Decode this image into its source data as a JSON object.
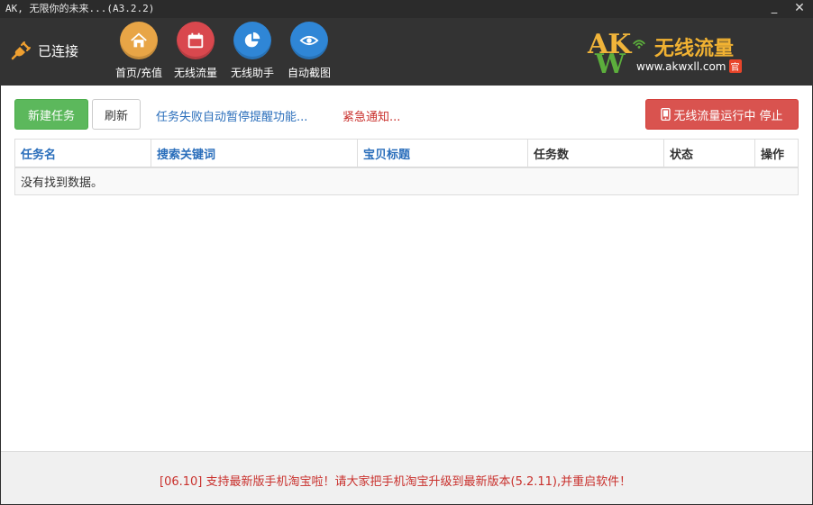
{
  "window": {
    "title": "AK, 无限你的未来...(A3.2.2)",
    "minimize_label": "_",
    "close_label": "✕"
  },
  "header": {
    "status": "已连接",
    "nav": [
      {
        "label": "首页/充值",
        "icon": "home-icon",
        "color": "#e8a546"
      },
      {
        "label": "无线流量",
        "icon": "calendar-icon",
        "color": "#d9484e"
      },
      {
        "label": "无线助手",
        "icon": "pie-chart-icon",
        "color": "#2f86d6"
      },
      {
        "label": "自动截图",
        "icon": "eye-icon",
        "color": "#2f86d6"
      }
    ]
  },
  "logo": {
    "letters_top": "AK",
    "letters_bottom": "W",
    "title": "无线流量",
    "url": "www.akwxll.com",
    "badge": "官"
  },
  "toolbar": {
    "new_task": "新建任务",
    "refresh": "刷新",
    "fail_link": "任务失败自动暂停提醒功能...",
    "urgent_link": "紧急通知...",
    "stop_button": "无线流量运行中 停止"
  },
  "table": {
    "columns": [
      "任务名",
      "搜索关键词",
      "宝贝标题",
      "任务数",
      "状态",
      "操作"
    ],
    "empty_message": "没有找到数据。"
  },
  "footer": {
    "notice": "[06.10] 支持最新版手机淘宝啦！请大家把手机淘宝升级到最新版本(5.2.11),并重启软件！"
  },
  "colors": {
    "header_bg": "#333333",
    "success": "#5cb85c",
    "danger": "#d9534f",
    "link": "#2a6ebb",
    "notice": "#c9302c"
  }
}
